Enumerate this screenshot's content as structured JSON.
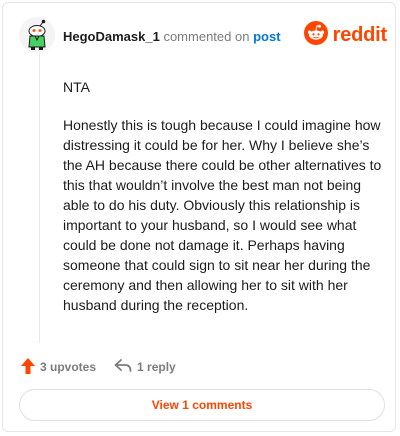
{
  "comment": {
    "username": "HegoDamask_1",
    "action_text": "commented on",
    "post_link": "post",
    "paragraphs": [
      "NTA",
      "Honestly this is tough because I could imagine how distressing it could be for her. Why I believe she’s the AH because there could be other alternatives to this that wouldn’t involve the best man not being able to do his duty. Obviously this relationship is important to your husband, so I would see what could be done not damage it. Perhaps having someone that could sign to sit near her during the ceremony and then allowing her to sit with her husband during the reception."
    ]
  },
  "brand": {
    "wordmark": "reddit",
    "color": "#ff4500"
  },
  "actions": {
    "upvotes": "3 upvotes",
    "replies": "1 reply"
  },
  "footer": {
    "view_comments": "View 1 comments"
  },
  "icons": {
    "avatar": "snoo-avatar-icon",
    "brand": "reddit-logo-icon",
    "upvote": "upvote-arrow-icon",
    "reply": "reply-arrow-icon"
  }
}
